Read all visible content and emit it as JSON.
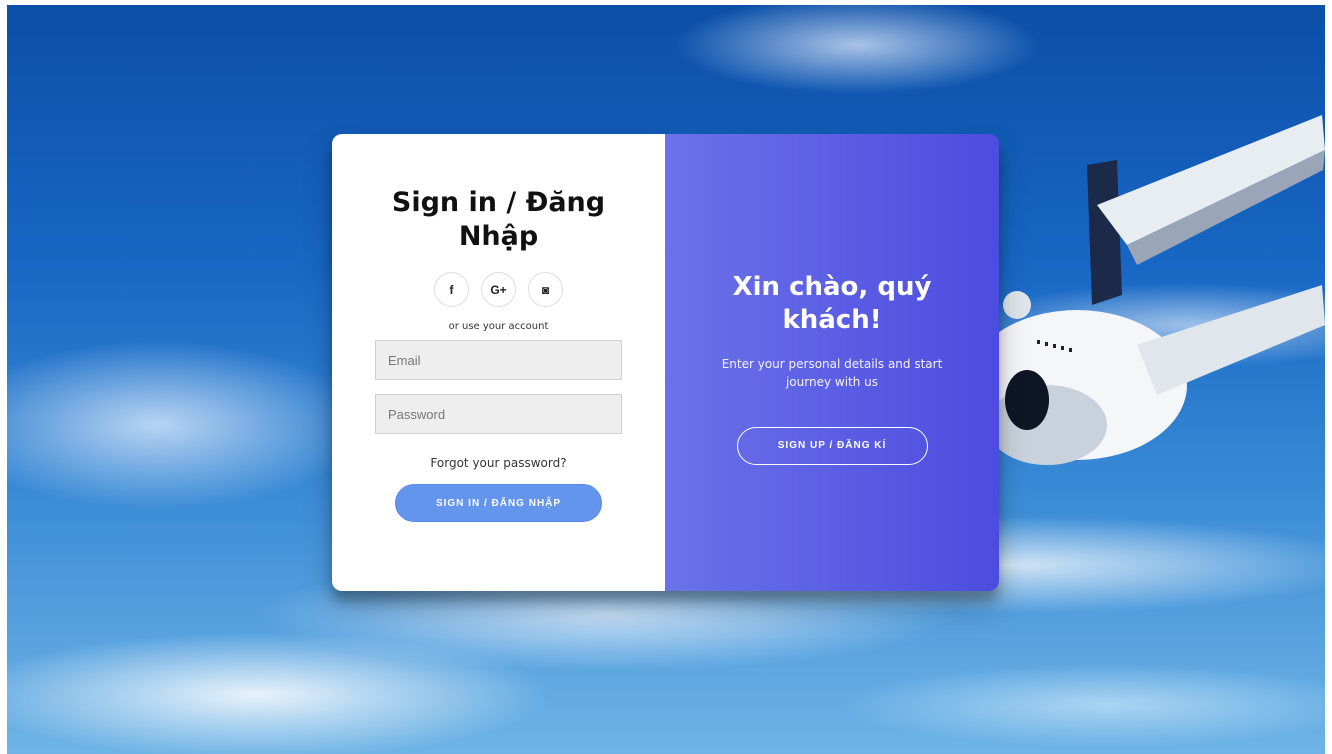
{
  "signin": {
    "title": "Sign in / Đăng Nhập",
    "socials": [
      {
        "label": "f",
        "icon": "facebook-icon"
      },
      {
        "label": "G+",
        "icon": "google-plus-icon"
      },
      {
        "label": "◙",
        "icon": "whatsapp-icon"
      }
    ],
    "hint": "or use your account",
    "email_placeholder": "Email",
    "password_placeholder": "Password",
    "forgot": "Forgot your password?",
    "submit_label": "SIGN IN / ĐĂNG NHẬP"
  },
  "overlay": {
    "title": "Xin chào, quý khách!",
    "subtitle": "Enter your personal details and start journey with us",
    "signup_label": "SIGN UP / ĐĂNG KÍ"
  },
  "colors": {
    "primary_button": "#6495ed",
    "panel_gradient_start": "#6b72e8",
    "panel_gradient_end": "#4c4ce0"
  }
}
